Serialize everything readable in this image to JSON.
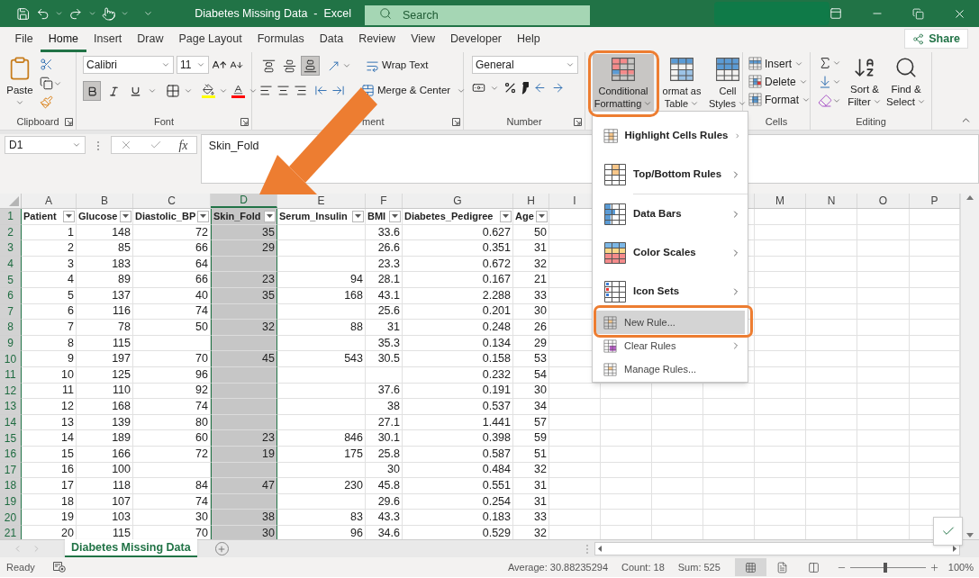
{
  "title_bar": {
    "title": "Diabetes Missing Data  -  Excel",
    "search_placeholder": "Search"
  },
  "menu_tabs": [
    {
      "label": "File",
      "selected": false
    },
    {
      "label": "Home",
      "selected": true
    },
    {
      "label": "Insert",
      "selected": false
    },
    {
      "label": "Draw",
      "selected": false
    },
    {
      "label": "Page Layout",
      "selected": false
    },
    {
      "label": "Formulas",
      "selected": false
    },
    {
      "label": "Data",
      "selected": false
    },
    {
      "label": "Review",
      "selected": false
    },
    {
      "label": "View",
      "selected": false
    },
    {
      "label": "Developer",
      "selected": false
    },
    {
      "label": "Help",
      "selected": false
    }
  ],
  "share": "Share",
  "ribbon": {
    "clipboard": {
      "paste": "Paste",
      "label": "Clipboard"
    },
    "font": {
      "name": "Calibri",
      "size": "11",
      "styles": [
        {
          "kind": "bold",
          "on": true
        },
        {
          "kind": "italic",
          "on": false
        },
        {
          "kind": "underline",
          "on": false
        }
      ],
      "label": "Font"
    },
    "alignment": {
      "vertical": [
        {
          "kind": "top",
          "on": false
        },
        {
          "kind": "middle",
          "on": false
        },
        {
          "kind": "bottom",
          "on": true
        }
      ],
      "wrap": "Wrap Text",
      "merge": "Merge & Center",
      "label": "ment"
    },
    "number": {
      "format": "General",
      "label": "Number"
    },
    "styles": [
      {
        "kind": "conditional",
        "lines": [
          "Conditional",
          "Formatting"
        ],
        "pressed": true
      },
      {
        "kind": "table",
        "lines": [
          "ormat as",
          "Table"
        ],
        "pressed": false
      },
      {
        "kind": "cell",
        "lines": [
          "Cell",
          "Styles"
        ],
        "pressed": false
      }
    ],
    "cells": {
      "items": [
        {
          "kind": "insert",
          "label": "Insert"
        },
        {
          "kind": "delete",
          "label": "Delete"
        },
        {
          "kind": "format",
          "label": "Format"
        }
      ],
      "label": "Cells"
    },
    "editing": {
      "items": [
        {
          "kind": "sort",
          "lines": [
            "Sort &",
            "Filter"
          ]
        },
        {
          "kind": "find",
          "lines": [
            "Find &",
            "Select"
          ]
        }
      ],
      "label": "Editing"
    }
  },
  "formula_bar": {
    "name_box": "D1",
    "fx": "fx",
    "content": "Skin_Fold"
  },
  "sheet": {
    "columns": [
      {
        "letter": "A",
        "selected": false
      },
      {
        "letter": "B",
        "selected": false
      },
      {
        "letter": "C",
        "selected": false
      },
      {
        "letter": "D",
        "selected": true
      },
      {
        "letter": "E",
        "selected": false
      },
      {
        "letter": "F",
        "selected": false
      },
      {
        "letter": "G",
        "selected": false
      },
      {
        "letter": "H",
        "selected": false
      },
      {
        "letter": "I",
        "selected": false
      },
      {
        "letter": "M",
        "selected": false
      },
      {
        "letter": "N",
        "selected": false
      },
      {
        "letter": "O",
        "selected": false
      },
      {
        "letter": "P",
        "selected": false
      }
    ],
    "rows": [
      {
        "number": "1",
        "kind": "header",
        "cells": [
          "Patient",
          "Glucose",
          "Diastolic_BP",
          "Skin_Fold",
          "Serum_Insulin",
          "BMI",
          "Diabetes_Pedigree",
          "Age"
        ]
      },
      {
        "number": "2",
        "kind": "data",
        "cells": [
          "1",
          "148",
          "72",
          "35",
          null,
          "33.6",
          "0.627",
          "50"
        ]
      },
      {
        "number": "3",
        "kind": "data",
        "cells": [
          "2",
          "85",
          "66",
          "29",
          null,
          "26.6",
          "0.351",
          "31"
        ]
      },
      {
        "number": "4",
        "kind": "data",
        "cells": [
          "3",
          "183",
          "64",
          null,
          null,
          "23.3",
          "0.672",
          "32"
        ]
      },
      {
        "number": "5",
        "kind": "data",
        "cells": [
          "4",
          "89",
          "66",
          "23",
          "94",
          "28.1",
          "0.167",
          "21"
        ]
      },
      {
        "number": "6",
        "kind": "data",
        "cells": [
          "5",
          "137",
          "40",
          "35",
          "168",
          "43.1",
          "2.288",
          "33"
        ]
      },
      {
        "number": "7",
        "kind": "data",
        "cells": [
          "6",
          "116",
          "74",
          null,
          null,
          "25.6",
          "0.201",
          "30"
        ]
      },
      {
        "number": "8",
        "kind": "data",
        "cells": [
          "7",
          "78",
          "50",
          "32",
          "88",
          "31",
          "0.248",
          "26"
        ]
      },
      {
        "number": "9",
        "kind": "data",
        "cells": [
          "8",
          "115",
          null,
          null,
          null,
          "35.3",
          "0.134",
          "29"
        ]
      },
      {
        "number": "10",
        "kind": "data",
        "cells": [
          "9",
          "197",
          "70",
          "45",
          "543",
          "30.5",
          "0.158",
          "53"
        ]
      },
      {
        "number": "11",
        "kind": "data",
        "cells": [
          "10",
          "125",
          "96",
          null,
          null,
          null,
          "0.232",
          "54"
        ]
      },
      {
        "number": "12",
        "kind": "data",
        "cells": [
          "11",
          "110",
          "92",
          null,
          null,
          "37.6",
          "0.191",
          "30"
        ]
      },
      {
        "number": "13",
        "kind": "data",
        "cells": [
          "12",
          "168",
          "74",
          null,
          null,
          "38",
          "0.537",
          "34"
        ]
      },
      {
        "number": "14",
        "kind": "data",
        "cells": [
          "13",
          "139",
          "80",
          null,
          null,
          "27.1",
          "1.441",
          "57"
        ]
      },
      {
        "number": "15",
        "kind": "data",
        "cells": [
          "14",
          "189",
          "60",
          "23",
          "846",
          "30.1",
          "0.398",
          "59"
        ]
      },
      {
        "number": "16",
        "kind": "data",
        "cells": [
          "15",
          "166",
          "72",
          "19",
          "175",
          "25.8",
          "0.587",
          "51"
        ]
      },
      {
        "number": "17",
        "kind": "data",
        "cells": [
          "16",
          "100",
          null,
          null,
          null,
          "30",
          "0.484",
          "32"
        ]
      },
      {
        "number": "18",
        "kind": "data",
        "cells": [
          "17",
          "118",
          "84",
          "47",
          "230",
          "45.8",
          "0.551",
          "31"
        ]
      },
      {
        "number": "19",
        "kind": "data",
        "cells": [
          "18",
          "107",
          "74",
          null,
          null,
          "29.6",
          "0.254",
          "31"
        ]
      },
      {
        "number": "20",
        "kind": "data",
        "cells": [
          "19",
          "103",
          "30",
          "38",
          "83",
          "43.3",
          "0.183",
          "33"
        ]
      },
      {
        "number": "21",
        "kind": "data",
        "cells": [
          "20",
          "115",
          "70",
          "30",
          "96",
          "34.6",
          "0.529",
          "32"
        ]
      }
    ]
  },
  "format_menu": {
    "items": [
      {
        "kind": "highlight",
        "label": "Highlight Cells Rules",
        "submenu": true,
        "selected": false
      },
      {
        "kind": "top_bottom",
        "label": "Top/Bottom Rules",
        "submenu": true,
        "selected": false
      },
      {
        "kind": "data_bars",
        "label": "Data Bars",
        "submenu": true,
        "selected": false
      },
      {
        "kind": "color_scales",
        "label": "Color Scales",
        "submenu": true,
        "selected": false
      },
      {
        "kind": "icon_sets",
        "label": "Icon Sets",
        "submenu": true,
        "selected": false
      },
      {
        "kind": "new_rule",
        "label": "New Rule...",
        "submenu": false,
        "selected": true
      },
      {
        "kind": "clear",
        "label": "Clear Rules",
        "submenu": true,
        "selected": false
      },
      {
        "kind": "manage",
        "label": "Manage Rules...",
        "submenu": false,
        "selected": false
      }
    ]
  },
  "sheet_tabs": [
    {
      "label": "Diabetes Missing Data",
      "selected": true
    }
  ],
  "status_bar": {
    "mode": "Ready",
    "stats": [
      "Average: 30.88235294",
      "Count: 18",
      "Sum: 525"
    ],
    "views": [
      {
        "kind": "normal",
        "selected": true
      },
      {
        "kind": "page_layout",
        "selected": false
      },
      {
        "kind": "page_break",
        "selected": false
      }
    ],
    "zoom": {
      "level": 0.47,
      "reading": "100%"
    }
  }
}
